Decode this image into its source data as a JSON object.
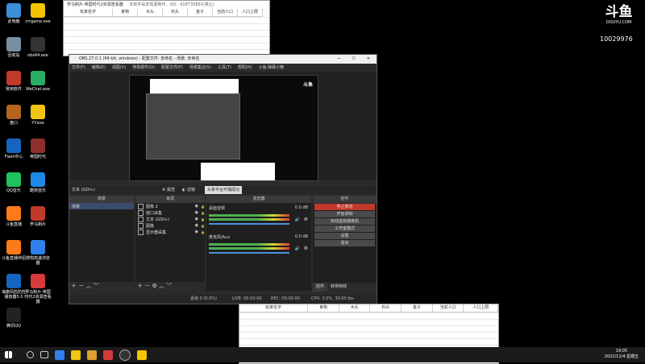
{
  "desktop": {
    "icons": [
      {
        "label": "此电脑",
        "color": "#3b8fd9"
      },
      {
        "label": "crrgame.exe",
        "color": "#f5c400"
      },
      {
        "label": "回收站",
        "color": "#7a8ea0"
      },
      {
        "label": "obs64.exe",
        "color": "#333"
      },
      {
        "label": "常用软件",
        "color": "#c0392b"
      },
      {
        "label": "WeChat.exe",
        "color": "#2aae67"
      },
      {
        "label": "盘口",
        "color": "#b5651d"
      },
      {
        "label": "YY.exe",
        "color": "#f1c40f"
      },
      {
        "label": "Flash中心",
        "color": "#1565c0"
      },
      {
        "label": "帝国时代",
        "color": "#8e2e2e"
      },
      {
        "label": "QQ音乐",
        "color": "#20c25b"
      },
      {
        "label": "酷狗音乐",
        "color": "#1e88e5"
      },
      {
        "label": "斗鱼直播",
        "color": "#ff7a1a"
      },
      {
        "label": "罗马制片",
        "color": "#c0392b"
      },
      {
        "label": "斗鱼直播伴侣",
        "color": "#ff7a1a"
      },
      {
        "label": "搜狗高速浏览器",
        "color": "#2f80ed"
      },
      {
        "label": "海康风险防控播放器5.0",
        "color": "#1565c0"
      },
      {
        "label": "罗马制片·帝国时代2资源查看器",
        "color": "#d63b3b"
      },
      {
        "label": "腾讯QQ",
        "color": "#222"
      }
    ]
  },
  "douyu": {
    "logo": "斗鱼",
    "domain": "DOUYU.COM",
    "room": "10029976"
  },
  "top_window": {
    "title": "罗马制片·帝国时代2资源查看器",
    "subtitle": "本软件由发现源制作，QQ：418733891(禁止)",
    "columns": [
      "玩家名字",
      "食物",
      "木头",
      "石头",
      "金子",
      "当前人口",
      "人口上限"
    ]
  },
  "bottom_window": {
    "columns": [
      "玩家名字",
      "食物",
      "木头",
      "石头",
      "金子",
      "当前人口",
      "人口上限"
    ]
  },
  "obs": {
    "title": "OBS 27.0.1 (64-bit, windows) - 配置文件: 未命名 - 场景: 未命名",
    "menu": [
      "文件(F)",
      "编辑(E)",
      "视图(V)",
      "停靠部件(D)",
      "配置文件(P)",
      "场景集合(S)",
      "工具(T)",
      "帮助(H)",
      "斗鱼·弹幕小精"
    ],
    "source_label": "文本 (GDI+)",
    "properties_btn": "属性",
    "filters_btn": "滤镜",
    "notice": "头条平台开播成功",
    "panels": {
      "scenes": "场景",
      "sources": "来源",
      "mixer": "混音器",
      "controls": "控件"
    },
    "scenes": [
      "场景"
    ],
    "sources": [
      "图像 2",
      "窗口采集",
      "文本 (GDI+)",
      "图像",
      "显示器采集"
    ],
    "mixer": [
      {
        "name": "桌面音频",
        "db": "0.0 dB"
      },
      {
        "name": "麦克风/Aux",
        "db": "0.0 dB"
      }
    ],
    "controls": [
      "停止推流",
      "开始录制",
      "启动虚拟摄像机",
      "工作室模式",
      "设置",
      "退出"
    ],
    "control_tabs": [
      "控件",
      "转场特效"
    ],
    "status": {
      "drop": "丢帧 0 (0.0%)",
      "live": "LIVE: 00:00:00",
      "rec": "REC: 00:00:00",
      "cpu": "CPU: 3.0%, 30.00 fps"
    }
  },
  "taskbar": {
    "time": "19:05",
    "date": "2022/11/4 星期五"
  }
}
